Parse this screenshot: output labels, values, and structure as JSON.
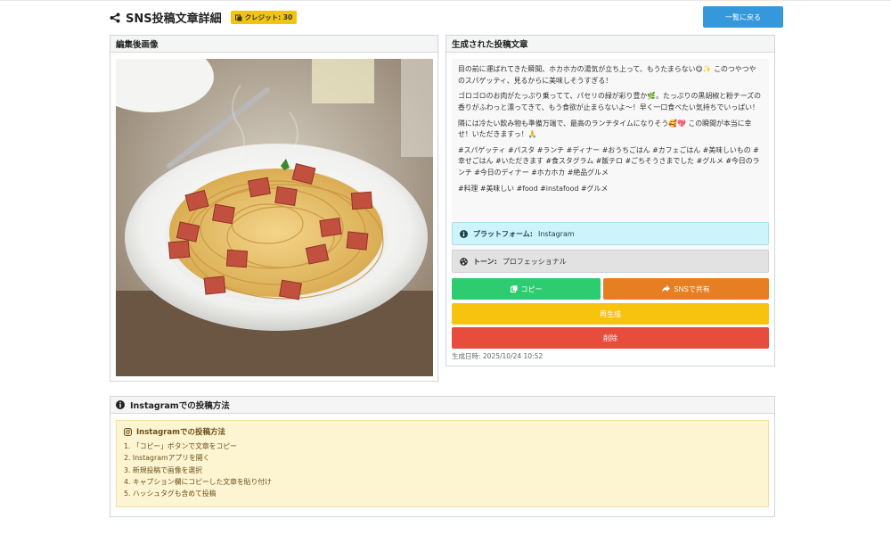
{
  "header": {
    "title": "SNS投稿文章詳細",
    "credit_label": "クレジット: 30",
    "back_label": "一覧に戻る"
  },
  "image_panel": {
    "title": "編集後画像"
  },
  "text_panel": {
    "title": "生成された投稿文章",
    "paragraphs": [
      "目の前に運ばれてきた瞬間、ホカホカの湯気が立ち上って、もうたまらない😋✨ このつやつやのスパゲッティ、見るからに美味しそうすぎる！",
      "ゴロゴロのお肉がたっぷり乗ってて、パセリの緑が彩り豊か🌿。たっぷりの黒胡椒と粉チーズの香りがふわっと漂ってきて、もう食欲が止まらないよ〜！早く一口食べたい気持ちでいっぱい！",
      "隣には冷たい飲み物も準備万端で、最高のランチタイムになりそう🥰💖 この瞬間が本当に幸せ！いただきますっ！🙏",
      "#スパゲッティ #パスタ #ランチ #ディナー #おうちごはん #カフェごはん #美味しいもの #幸せごはん #いただきます #食スタグラム #飯テロ #ごちそうさまでした #グルメ #今日のランチ #今日のディナー #ホカホカ #絶品グルメ",
      "#料理 #美味しい #food #instafood #グルメ"
    ],
    "platform_label": "プラットフォーム:",
    "platform_value": "Instagram",
    "tone_label": "トーン:",
    "tone_value": "プロフェッショナル",
    "copy_label": "コピー",
    "share_label": "SNSで共有",
    "regenerate_label": "再生成",
    "delete_label": "削除",
    "generated_at": "生成日時: 2025/10/24 10:52"
  },
  "howto_panel": {
    "title": "Instagramでの投稿方法",
    "box_title": "Instagramでの投稿方法",
    "steps": [
      "1. 「コピー」ボタンで文章をコピー",
      "2. Instagramアプリを開く",
      "3. 新規投稿で画像を選択",
      "4. キャプション欄にコピーした文章を貼り付け",
      "5. ハッシュタグも含めて投稿"
    ]
  },
  "colors": {
    "primary": "#3498db",
    "success": "#2ecc71",
    "orange": "#e67e22",
    "warning": "#f7c30f",
    "danger": "#e74c3c",
    "info_bg": "#cdf3fb",
    "howto_bg": "#fdf4d2"
  },
  "icons": {
    "header": "share-nodes-icon",
    "credit": "coins-icon",
    "platform": "info-circle-icon",
    "tone": "palette-icon",
    "copy": "copy-icon",
    "share": "share-arrow-icon",
    "howto": "info-circle-icon",
    "instagram": "instagram-icon"
  }
}
